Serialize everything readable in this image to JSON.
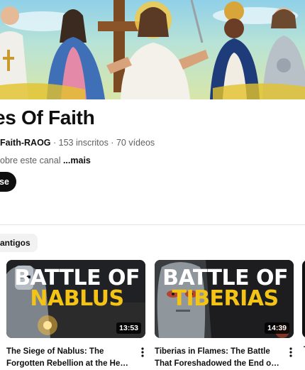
{
  "banner": {
    "alt": ""
  },
  "channel": {
    "title": "es Of Faith",
    "handle": "Faith-RAOG",
    "subscribers": "153 inscritos",
    "videos": "70 vídeos",
    "separator": " · ",
    "description": "obre este canal ",
    "more_label": "...mais",
    "subscribe_label": "se"
  },
  "filters": {
    "chip_label": "antigos"
  },
  "videos": [
    {
      "title": "The Siege of Nablus: The Forgotten Rebellion at the Heart of the Latin Kingdom",
      "thumb_line1": "BATTLE OF",
      "thumb_line2": "NABLUS",
      "duration": "13:53"
    },
    {
      "title": "Tiberias in Flames: The Battle That Foreshadowed the End of the Crusader Kingdom",
      "thumb_line1": "BATTLE OF",
      "thumb_line2": "TIBERIAS",
      "duration": "14:39"
    }
  ],
  "peek": {
    "text": "T"
  },
  "colors": {
    "accent_yellow": "#f3c316",
    "text_primary": "#0f0f0f",
    "text_secondary": "#606060",
    "chip_bg": "#f2f2f2"
  }
}
